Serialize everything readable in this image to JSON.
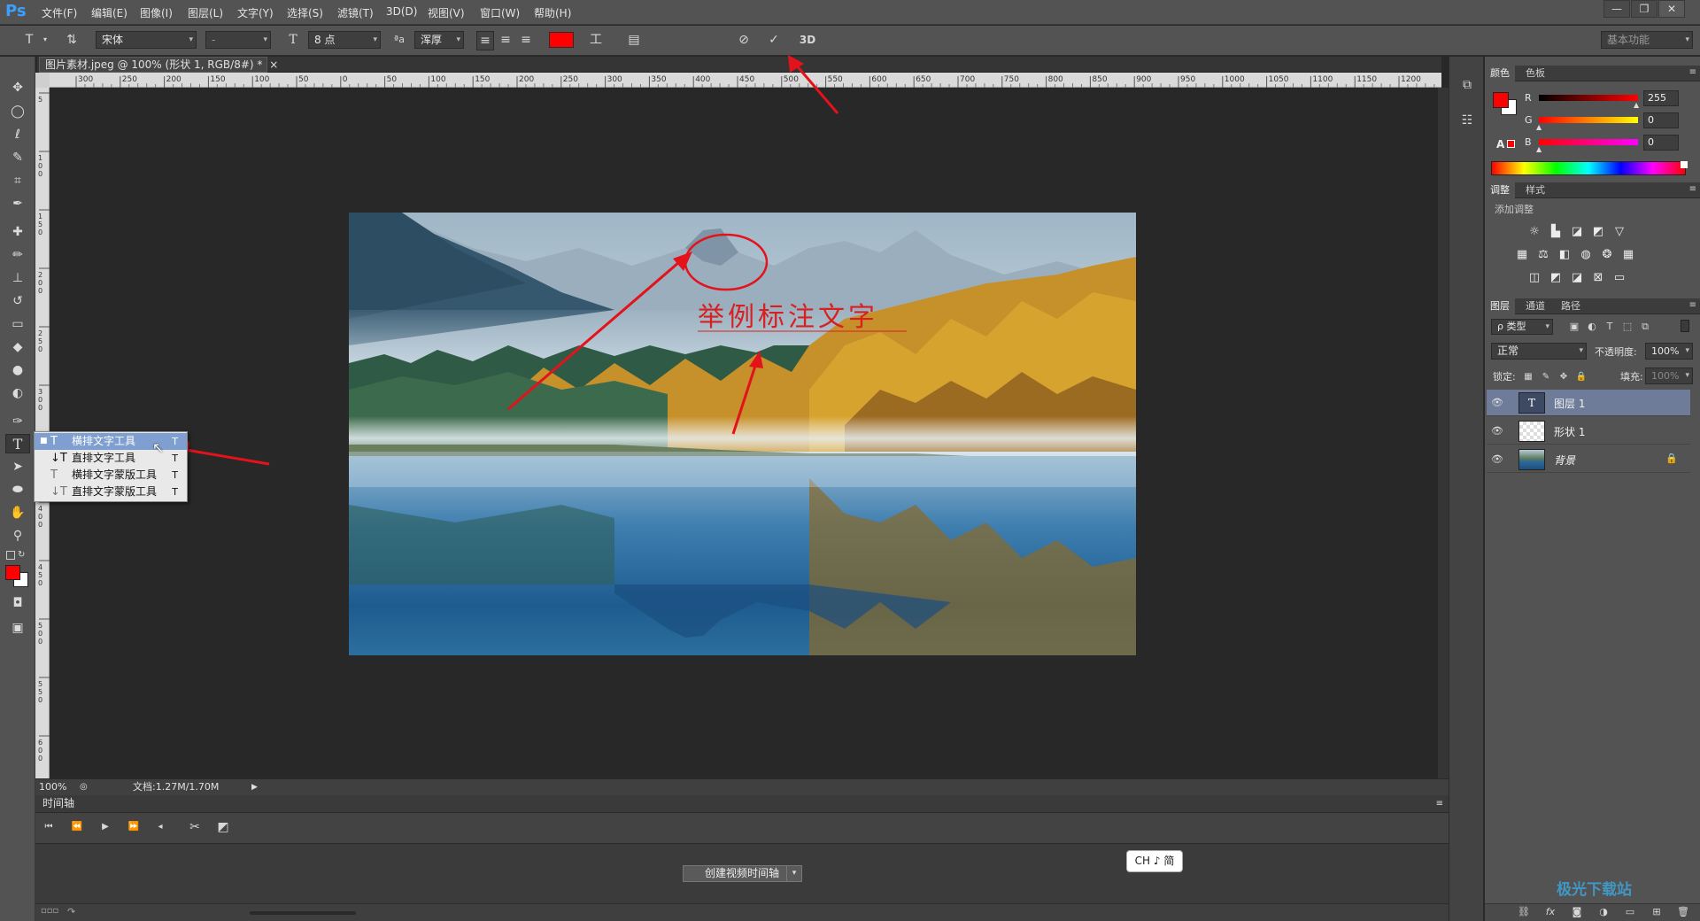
{
  "app": {
    "logo": "Ps",
    "workspace": "基本功能"
  },
  "menu": [
    "文件(F)",
    "编辑(E)",
    "图像(I)",
    "图层(L)",
    "文字(Y)",
    "选择(S)",
    "滤镜(T)",
    "3D(D)",
    "视图(V)",
    "窗口(W)",
    "帮助(H)"
  ],
  "window_controls": [
    "—",
    "❐",
    "✕"
  ],
  "options": {
    "font_family": "宋体",
    "font_style": "-",
    "font_size": "8 点",
    "aa_label": "ªa",
    "anti_alias": "浑厚",
    "text_color": "#ff0000",
    "mode_3d": "3D"
  },
  "document": {
    "tab_title": "图片素材.jpeg @ 100% (形状 1, RGB/8#) *",
    "close": "×"
  },
  "ruler": {
    "h_labels": [
      "300",
      "250",
      "200",
      "150",
      "100",
      "50",
      "0",
      "50",
      "100",
      "150",
      "200",
      "250",
      "300",
      "350",
      "400",
      "450",
      "500",
      "550",
      "600",
      "650",
      "700",
      "750",
      "800",
      "850",
      "900",
      "950",
      "1000",
      "1050",
      "1100",
      "1150",
      "1200"
    ],
    "v_labels": [
      "5",
      "1 0 0",
      "1 5 0",
      "2 0 0",
      "2 5 0",
      "3 0 0",
      "3 5 0",
      "4 0 0",
      "4 5 0",
      "5 0 0",
      "5 5 0",
      "6 0 0"
    ]
  },
  "flyout": {
    "items": [
      {
        "label": "横排文字工具",
        "shortcut": "T",
        "selected": true
      },
      {
        "label": "直排文字工具",
        "shortcut": "T"
      },
      {
        "label": "横排文字蒙版工具",
        "shortcut": "T"
      },
      {
        "label": "直排文字蒙版工具",
        "shortcut": "T"
      }
    ]
  },
  "canvas": {
    "annotation_text": "举例标注文字"
  },
  "status": {
    "zoom": "100%",
    "doc_size": "文档:1.27M/1.70M"
  },
  "timeline": {
    "title": "时间轴",
    "create_button": "创建视频时间轴"
  },
  "ime": {
    "label": "CH ♪ 简"
  },
  "color_panel": {
    "tabs": [
      "颜色",
      "色板"
    ],
    "r_label": "R",
    "g_label": "G",
    "b_label": "B",
    "r": "255",
    "g": "0",
    "b": "0",
    "foreground": "#ff0000",
    "background": "#ffffff"
  },
  "adjust_panel": {
    "tabs": [
      "调整",
      "样式"
    ],
    "hint": "添加调整"
  },
  "layers_panel": {
    "tabs": [
      "图层",
      "通道",
      "路径"
    ],
    "filter": "ρ 类型",
    "blend_mode": "正常",
    "opacity_label": "不透明度:",
    "opacity": "100%",
    "lock_label": "锁定:",
    "fill_label": "填充:",
    "fill": "100%",
    "layers": [
      {
        "name": "图层 1",
        "selected": true
      },
      {
        "name": "形状 1"
      },
      {
        "name": "背景",
        "locked": true
      }
    ]
  },
  "watermark": "极光下载站"
}
